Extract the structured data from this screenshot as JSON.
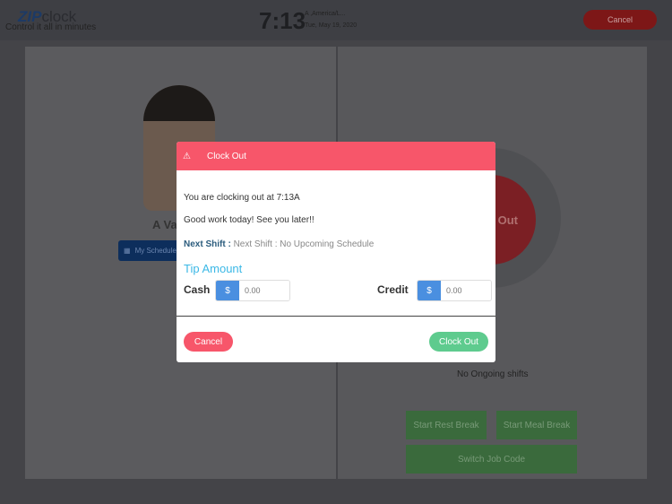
{
  "header": {
    "logo_zip": "ZIP",
    "logo_clock": "clock",
    "tagline": "Control it all in minutes",
    "time": "7:13",
    "timezone": "A ,America/L...",
    "date": "Tue, May 19, 2020",
    "cancel": "Cancel"
  },
  "profile": {
    "name": "A Va",
    "my_schedule": "My Schedule"
  },
  "clock": {
    "circle_label": "Out",
    "no_shifts": "No Ongoing shifts",
    "start_rest_break": "Start Rest Break",
    "start_meal_break": "Start Meal Break",
    "switch_job_code": "Switch Job Code"
  },
  "modal": {
    "title": "Clock Out",
    "message": "You are clocking out at 7:13A",
    "greeting": "Good work today! See you later!!",
    "next_shift_label": "Next Shift :",
    "next_shift_value": "Next Shift : No Upcoming Schedule",
    "tip_amount": "Tip Amount",
    "cash_label": "Cash",
    "credit_label": "Credit",
    "currency": "$",
    "placeholder": "0.00",
    "cancel": "Cancel",
    "clock_out": "Clock Out"
  }
}
